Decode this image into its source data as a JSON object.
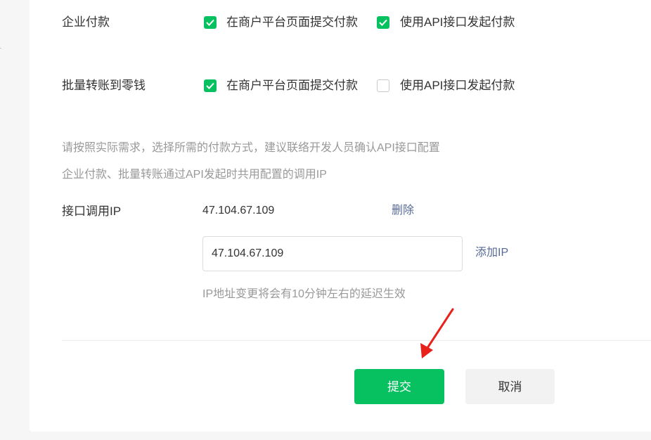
{
  "settings": {
    "enterprise_payment": {
      "label": "企业付款",
      "options": [
        {
          "label": "在商户平台页面提交付款",
          "checked": true
        },
        {
          "label": "使用API接口发起付款",
          "checked": true
        }
      ]
    },
    "batch_transfer": {
      "label": "批量转账到零钱",
      "options": [
        {
          "label": "在商户平台页面提交付款",
          "checked": true
        },
        {
          "label": "使用API接口发起付款",
          "checked": false
        }
      ]
    },
    "hint_line1": "请按照实际需求，选择所需的付款方式，建议联络开发人员确认API接口配置",
    "hint_line2": "企业付款、批量转账通过API发起时共用配置的调用IP"
  },
  "ip_config": {
    "label": "接口调用IP",
    "existing_ip": "47.104.67.109",
    "delete_label": "删除",
    "input_value": "47.104.67.109",
    "add_label": "添加IP",
    "note": "IP地址变更将会有10分钟左右的延迟生效"
  },
  "actions": {
    "submit_label": "提交",
    "cancel_label": "取消"
  },
  "colors": {
    "accent": "#07c160",
    "link": "#576b95",
    "annotation_arrow": "#e8221b"
  }
}
